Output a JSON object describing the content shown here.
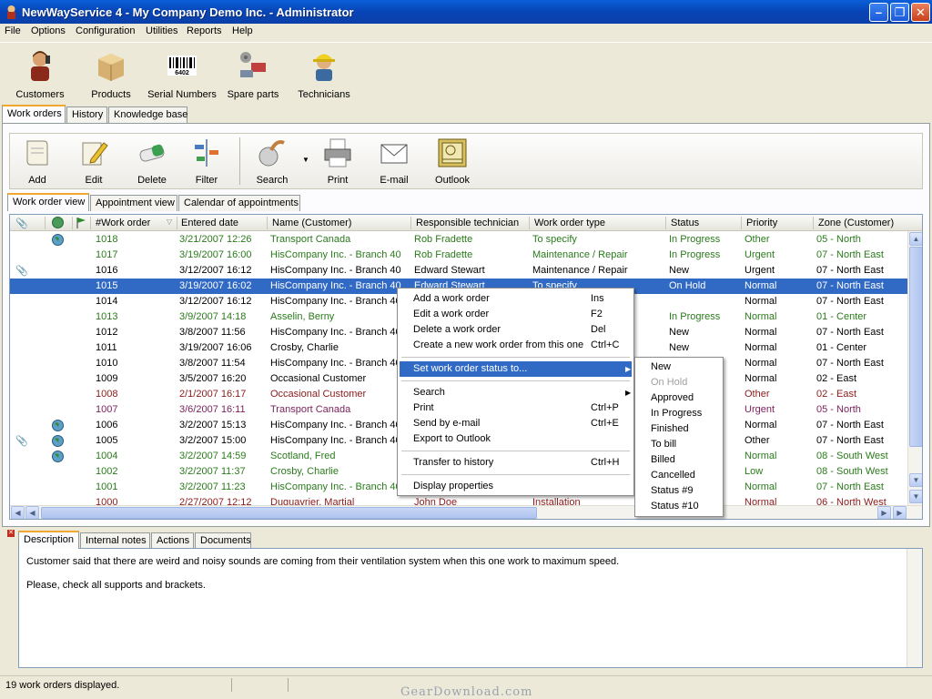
{
  "window": {
    "title": "NewWayService 4 - My Company Demo Inc. - Administrator"
  },
  "menu": [
    "File",
    "Options",
    "Configuration",
    "Utilities",
    "Reports",
    "Help"
  ],
  "main_toolbar": [
    {
      "label": "Customers",
      "icon": "customer-person-icon"
    },
    {
      "label": "Products",
      "icon": "box-icon"
    },
    {
      "label": "Serial Numbers",
      "icon": "barcode-icon"
    },
    {
      "label": "Spare parts",
      "icon": "spare-parts-icon"
    },
    {
      "label": "Technicians",
      "icon": "technician-hardhat-icon"
    }
  ],
  "barcode_text": "6402",
  "top_tabs": [
    "Work orders",
    "History",
    "Knowledge base"
  ],
  "action_toolbar": [
    {
      "label": "Add",
      "icon": "add-scroll-icon"
    },
    {
      "label": "Edit",
      "icon": "edit-pencil-icon"
    },
    {
      "label": "Delete",
      "icon": "eraser-icon"
    },
    {
      "label": "Filter",
      "icon": "filter-icon"
    },
    {
      "label": "Search",
      "icon": "search-icon"
    },
    {
      "label": "Print",
      "icon": "printer-icon"
    },
    {
      "label": "E-mail",
      "icon": "envelope-icon"
    },
    {
      "label": "Outlook",
      "icon": "outlook-icon"
    }
  ],
  "view_tabs": [
    "Work order view",
    "Appointment view",
    "Calendar of appointments"
  ],
  "columns": [
    "#Work order",
    "Entered date",
    "Name (Customer)",
    "Responsible technician",
    "Work order type",
    "Status",
    "Priority",
    "Zone (Customer)"
  ],
  "rows": [
    {
      "wo": "1018",
      "date": "3/21/2007 12:26",
      "name": "Transport Canada",
      "tech": "Rob Fradette",
      "type": "To specify",
      "status": "In Progress",
      "priority": "Other",
      "zone": "05 - North",
      "color": "green",
      "globe": true,
      "clip": false
    },
    {
      "wo": "1017",
      "date": "3/19/2007 16:00",
      "name": "HisCompany Inc. - Branch 40",
      "tech": "Rob Fradette",
      "type": "Maintenance / Repair",
      "status": "In Progress",
      "priority": "Urgent",
      "zone": "07 - North East",
      "color": "green",
      "globe": false,
      "clip": false
    },
    {
      "wo": "1016",
      "date": "3/12/2007 16:12",
      "name": "HisCompany Inc. - Branch 40",
      "tech": "Edward Stewart",
      "type": "Maintenance / Repair",
      "status": "New",
      "priority": "Urgent",
      "zone": "07 - North East",
      "color": "black",
      "globe": false,
      "clip": true
    },
    {
      "wo": "1015",
      "date": "3/19/2007 16:02",
      "name": "HisCompany Inc. - Branch 40",
      "tech": "Edward Stewart",
      "type": "To specify",
      "status": "On Hold",
      "priority": "Normal",
      "zone": "07 - North East",
      "color": "sel",
      "globe": false,
      "clip": false
    },
    {
      "wo": "1014",
      "date": "3/12/2007 16:12",
      "name": "HisCompany Inc. - Branch 40",
      "tech": "",
      "type": "",
      "status": "",
      "priority": "Normal",
      "zone": "07 - North East",
      "color": "black",
      "globe": false,
      "clip": false
    },
    {
      "wo": "1013",
      "date": "3/9/2007 14:18",
      "name": "Asselin, Berny",
      "tech": "",
      "type": "",
      "status": "In Progress",
      "priority": "Normal",
      "zone": "01 - Center",
      "color": "green",
      "globe": false,
      "clip": false
    },
    {
      "wo": "1012",
      "date": "3/8/2007 11:56",
      "name": "HisCompany Inc. - Branch 40",
      "tech": "",
      "type": "",
      "status": "New",
      "priority": "Normal",
      "zone": "07 - North East",
      "color": "black",
      "globe": false,
      "clip": false
    },
    {
      "wo": "1011",
      "date": "3/19/2007 16:06",
      "name": "Crosby, Charlie",
      "tech": "",
      "type": "",
      "status": "New",
      "priority": "Normal",
      "zone": "01 - Center",
      "color": "black",
      "globe": false,
      "clip": false
    },
    {
      "wo": "1010",
      "date": "3/8/2007 11:54",
      "name": "HisCompany Inc. - Branch 40",
      "tech": "",
      "type": "",
      "status": "",
      "priority": "Normal",
      "zone": "07 - North East",
      "color": "black",
      "globe": false,
      "clip": false
    },
    {
      "wo": "1009",
      "date": "3/5/2007 16:20",
      "name": "Occasional Customer",
      "tech": "",
      "type": "",
      "status": "",
      "priority": "Normal",
      "zone": "02 - East",
      "color": "black",
      "globe": false,
      "clip": false
    },
    {
      "wo": "1008",
      "date": "2/1/2007 16:17",
      "name": "Occasional Customer",
      "tech": "",
      "type": "",
      "status": "",
      "priority": "Other",
      "zone": "02 - East",
      "color": "maroon",
      "globe": false,
      "clip": false
    },
    {
      "wo": "1007",
      "date": "3/6/2007 16:11",
      "name": "Transport Canada",
      "tech": "",
      "type": "",
      "status": "",
      "priority": "Urgent",
      "zone": "05 - North",
      "color": "purple",
      "globe": false,
      "clip": false
    },
    {
      "wo": "1006",
      "date": "3/2/2007 15:13",
      "name": "HisCompany Inc. - Branch 40",
      "tech": "",
      "type": "",
      "status": "",
      "priority": "Normal",
      "zone": "07 - North East",
      "color": "black",
      "globe": true,
      "clip": false
    },
    {
      "wo": "1005",
      "date": "3/2/2007 15:00",
      "name": "HisCompany Inc. - Branch 40",
      "tech": "",
      "type": "",
      "status": "",
      "priority": "Other",
      "zone": "07 - North East",
      "color": "black",
      "globe": true,
      "clip": true
    },
    {
      "wo": "1004",
      "date": "3/2/2007 14:59",
      "name": "Scotland, Fred",
      "tech": "",
      "type": "",
      "status": "",
      "priority": "Normal",
      "zone": "08 - South West",
      "color": "green",
      "globe": true,
      "clip": false
    },
    {
      "wo": "1002",
      "date": "3/2/2007 11:37",
      "name": "Crosby, Charlie",
      "tech": "",
      "type": "",
      "status": "",
      "priority": "Low",
      "zone": "08 - South West",
      "color": "green",
      "globe": false,
      "clip": false
    },
    {
      "wo": "1001",
      "date": "3/2/2007 11:23",
      "name": "HisCompany Inc. - Branch 40",
      "tech": "",
      "type": "",
      "status": "",
      "priority": "Normal",
      "zone": "07 - North East",
      "color": "green",
      "globe": false,
      "clip": false
    },
    {
      "wo": "1000",
      "date": "2/27/2007 12:12",
      "name": "Duguayrier, Martial",
      "tech": "John Doe",
      "type": "Installation",
      "status": "",
      "priority": "Normal",
      "zone": "06 - North West",
      "color": "maroon",
      "globe": false,
      "clip": false
    }
  ],
  "context_menu": [
    {
      "label": "Add a work order",
      "key": "Ins"
    },
    {
      "label": "Edit a work order",
      "key": "F2"
    },
    {
      "label": "Delete a work order",
      "key": "Del"
    },
    {
      "label": "Create a new work order from this one",
      "key": "Ctrl+C"
    },
    {
      "sep": true
    },
    {
      "label": "Set work order status to...",
      "key": "",
      "submenu": true,
      "highlight": true
    },
    {
      "sep": true
    },
    {
      "label": "Search",
      "key": "",
      "submenu": true
    },
    {
      "label": "Print",
      "key": "Ctrl+P"
    },
    {
      "label": "Send by e-mail",
      "key": "Ctrl+E"
    },
    {
      "label": "Export to Outlook",
      "key": ""
    },
    {
      "sep": true
    },
    {
      "label": "Transfer to history",
      "key": "Ctrl+H"
    },
    {
      "sep": true
    },
    {
      "label": "Display properties",
      "key": ""
    }
  ],
  "status_submenu": [
    {
      "label": "New",
      "disabled": false
    },
    {
      "label": "On Hold",
      "disabled": true
    },
    {
      "label": "Approved",
      "disabled": false
    },
    {
      "label": "In Progress",
      "disabled": false
    },
    {
      "label": "Finished",
      "disabled": false
    },
    {
      "label": "To bill",
      "disabled": false
    },
    {
      "label": "Billed",
      "disabled": false
    },
    {
      "label": "Cancelled",
      "disabled": false
    },
    {
      "label": "Status #9",
      "disabled": false
    },
    {
      "label": "Status #10",
      "disabled": false
    }
  ],
  "detail_tabs": [
    "Description",
    "Internal notes",
    "Actions",
    "Documents"
  ],
  "description": [
    "Customer said that there are weird and noisy sounds are coming from their ventilation system when this one work to maximum speed.",
    "Please, check all supports and brackets."
  ],
  "status_bar": "19 work orders displayed.",
  "watermark": "GearDownload.com"
}
